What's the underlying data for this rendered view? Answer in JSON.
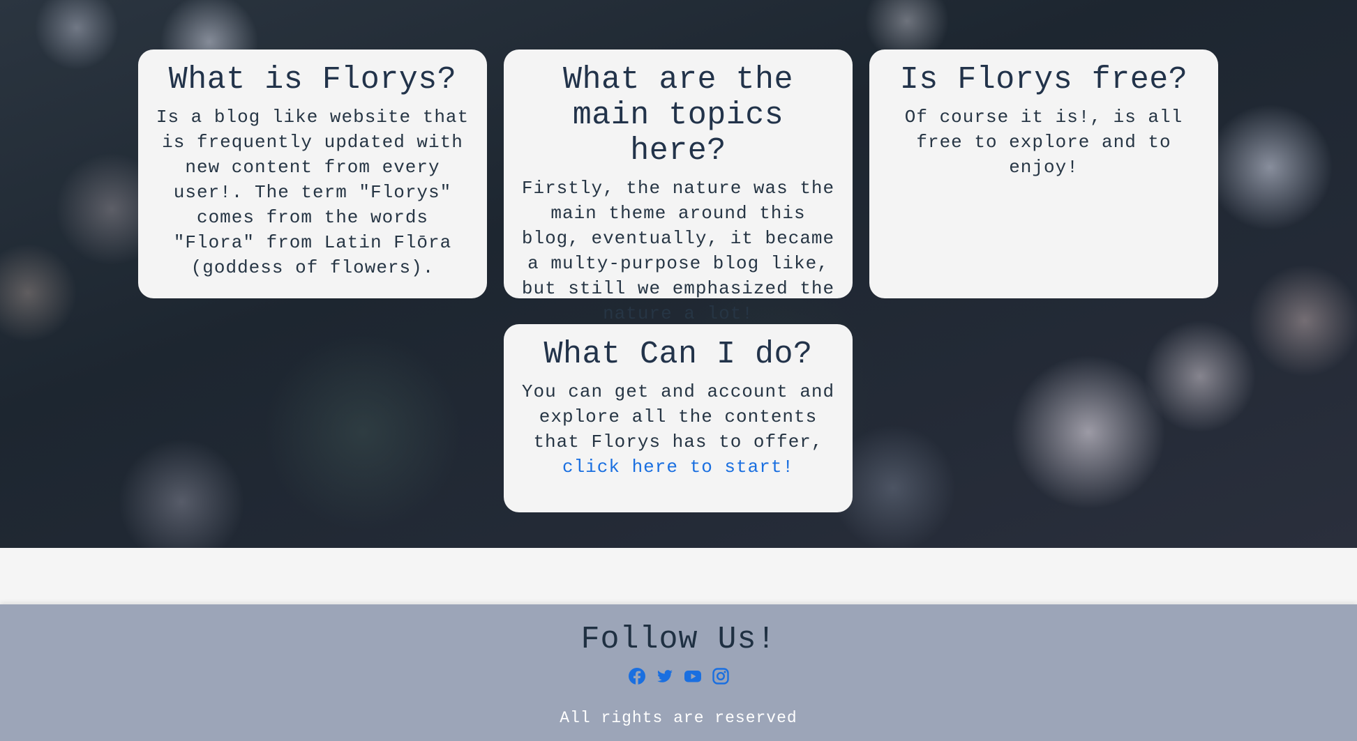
{
  "cards": [
    {
      "title": "What is Florys?",
      "text": "Is a blog like website that is frequently updated with new content from every user!. The term \"Florys\" comes from the words \"Flora\" from Latin Flōra (goddess of flowers)."
    },
    {
      "title": "What are the main topics here?",
      "text": "Firstly, the nature was the main theme around this blog, eventually, it became a multy-purpose blog like, but still we emphasized the nature a lot!"
    },
    {
      "title": "Is Florys free?",
      "text": "Of course it is!, is all free to explore and to enjoy!"
    },
    {
      "title": "What Can I do?",
      "text": "You can get and account and explore all the contents that Florys has to offer, ",
      "link": "click here to start!"
    }
  ],
  "footer": {
    "title": "Follow Us!",
    "socials": [
      "facebook-icon",
      "twitter-icon",
      "youtube-icon",
      "instagram-icon"
    ],
    "rights": "All rights are reserved"
  },
  "colors": {
    "card_bg": "#f4f4f4",
    "text": "#263544",
    "link": "#1a6fe0",
    "footer_bg": "#9ca5b8",
    "icon": "#1a6fe0"
  }
}
